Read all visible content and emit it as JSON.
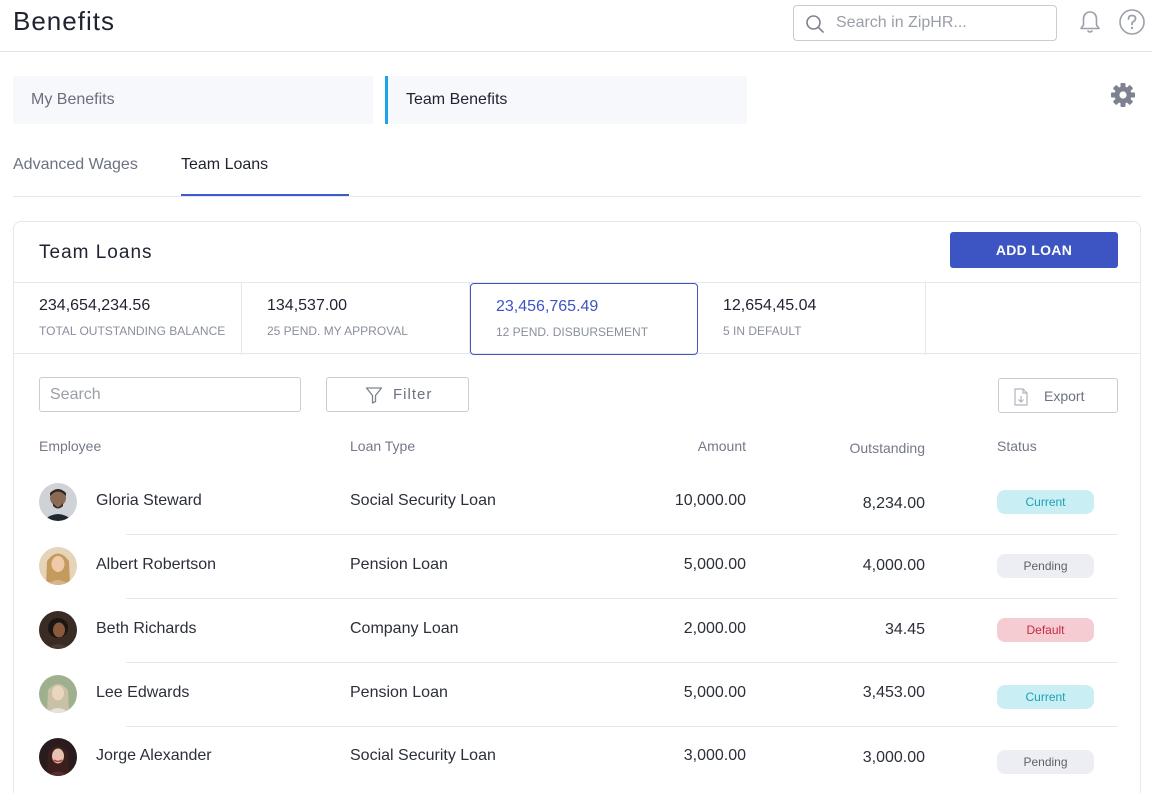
{
  "header": {
    "title": "Benefits",
    "search_placeholder": "Search in ZipHR..."
  },
  "main_tabs": [
    {
      "label": "My Benefits",
      "active": false
    },
    {
      "label": "Team Benefits",
      "active": true
    }
  ],
  "sub_tabs": [
    {
      "label": "Advanced Wages",
      "active": false
    },
    {
      "label": "Team Loans",
      "active": true
    }
  ],
  "card": {
    "title": "Team Loans",
    "add_button": "ADD LOAN"
  },
  "stats": [
    {
      "value": "234,654,234.56",
      "label": "TOTAL OUTSTANDING BALANCE"
    },
    {
      "value": "134,537.00",
      "label": "25 PEND. MY APPROVAL"
    },
    {
      "value": "23,456,765.49",
      "label": "12 PEND. DISBURSEMENT",
      "selected": true
    },
    {
      "value": "12,654,45.04",
      "label": "5 IN DEFAULT"
    }
  ],
  "toolbar": {
    "search_placeholder": "Search",
    "filter_label": "Filter",
    "export_label": "Export"
  },
  "columns": [
    "Employee",
    "Loan Type",
    "Amount",
    "Outstanding",
    "Status"
  ],
  "rows": [
    {
      "employee": "Gloria Steward",
      "loan_type": "Social Security Loan",
      "amount": "10,000.00",
      "outstanding": "8,234.00",
      "status": "Current"
    },
    {
      "employee": "Albert Robertson",
      "loan_type": "Pension Loan",
      "amount": "5,000.00",
      "outstanding": "4,000.00",
      "status": "Pending"
    },
    {
      "employee": "Beth Richards",
      "loan_type": "Company Loan",
      "amount": "2,000.00",
      "outstanding": "34.45",
      "status": "Default"
    },
    {
      "employee": "Lee Edwards",
      "loan_type": "Pension Loan",
      "amount": "5,000.00",
      "outstanding": "3,453.00",
      "status": "Current"
    },
    {
      "employee": "Jorge Alexander",
      "loan_type": "Social Security Loan",
      "amount": "3,000.00",
      "outstanding": "3,000.00",
      "status": "Pending"
    }
  ],
  "icons": {
    "search": "search-icon",
    "bell": "bell-icon",
    "help": "help-icon",
    "settings": "gear-icon",
    "filter": "filter-icon",
    "export": "export-icon"
  },
  "colors": {
    "accent": "#3d55c2",
    "tab_indicator": "#1aa3e8",
    "status_current": "#1ea2b4",
    "status_pending": "#5d6270",
    "status_default": "#c42b47"
  }
}
